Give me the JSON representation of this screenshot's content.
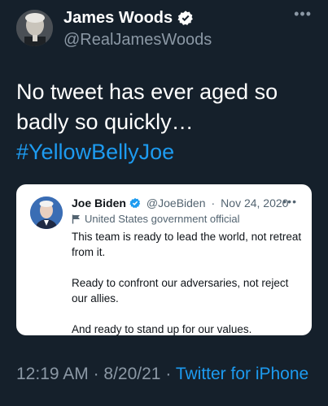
{
  "author": {
    "name": "James Woods",
    "handle": "@RealJamesWoods"
  },
  "tweet": {
    "lines": [
      "No tweet has ever aged so",
      "badly so quickly…"
    ],
    "hashtag": "#YellowBellyJoe"
  },
  "quoted_tweet": {
    "name": "Joe Biden",
    "handle": "@JoeBiden",
    "separator": "·",
    "date": "Nov 24, 2020",
    "label": "United States government official",
    "paragraphs": [
      "This team is ready to lead the world, not retreat from it.",
      "Ready to confront our adversaries, not reject our allies.",
      "And ready to stand up for our values."
    ]
  },
  "footer": {
    "time": "12:19 AM",
    "date": "8/20/21",
    "separator": "·",
    "source": "Twitter for iPhone"
  },
  "colors": {
    "background": "#15202b",
    "accent": "#1d9bf0",
    "muted": "#8b98a5"
  },
  "icons": [
    "verified-badge-icon",
    "more-options-icon",
    "government-flag-icon"
  ]
}
